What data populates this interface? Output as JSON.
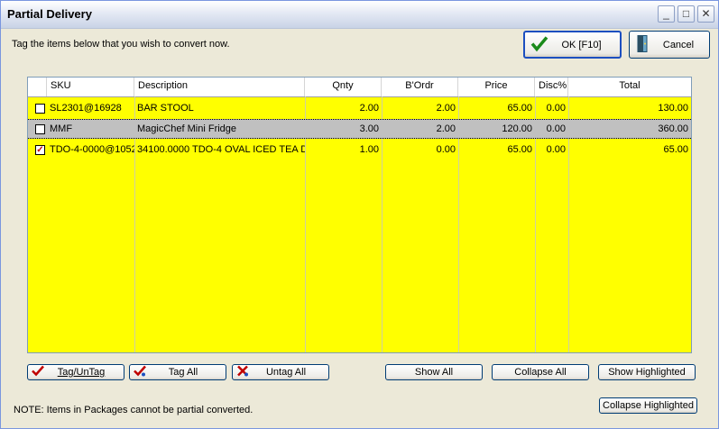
{
  "window": {
    "title": "Partial Delivery"
  },
  "titlebar": {
    "minimize_icon": "minimize-icon",
    "maximize_icon": "maximize-icon",
    "close_icon": "close-icon"
  },
  "instructions": "Tag the items below that you wish to convert now.",
  "buttons": {
    "ok": "OK [F10]",
    "cancel": "Cancel",
    "tag_untag": "Tag/UnTag",
    "tag_all": "Tag All",
    "untag_all": "Untag All",
    "show_all": "Show All",
    "collapse_all": "Collapse All",
    "show_highlighted": "Show Highlighted",
    "collapse_highlighted": "Collapse Highlighted"
  },
  "grid": {
    "columns": [
      "SKU",
      "Description",
      "Qnty",
      "B'Ordr",
      "Price",
      "Disc%",
      "Total"
    ],
    "rows": [
      {
        "checked": false,
        "sku": "SL2301@16928",
        "description": "BAR STOOL",
        "qnty": "2.00",
        "bordr": "2.00",
        "price": "65.00",
        "disc": "0.00",
        "total": "130.00"
      },
      {
        "checked": false,
        "sku": "MMF",
        "description": "MagicChef Mini Fridge",
        "qnty": "3.00",
        "bordr": "2.00",
        "price": "120.00",
        "disc": "0.00",
        "total": "360.00"
      },
      {
        "checked": true,
        "sku": "TDO-4-0000@1052",
        "description": "34100.0000 TDO-4 OVAL ICED TEA D",
        "qnty": "1.00",
        "bordr": "0.00",
        "price": "65.00",
        "disc": "0.00",
        "total": "65.00"
      }
    ],
    "background_color": "#ffff00",
    "selected_row_color": "#c0c0c0"
  },
  "note": "NOTE: Items in Packages cannot be partial converted."
}
